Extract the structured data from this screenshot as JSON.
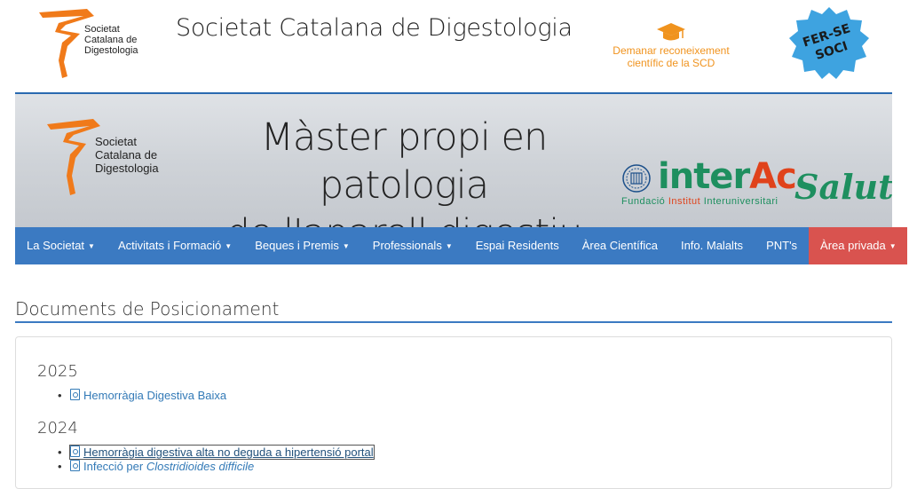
{
  "header": {
    "logo_text": [
      "Societat",
      "Catalana de",
      "Digestologia"
    ],
    "site_title": "Societat Catalana de Digestologia",
    "recognition_link": [
      "Demanar reconeixement",
      "científic de la SCD"
    ],
    "badge_text": [
      "FER-SE",
      "SOCI"
    ],
    "icons": [
      "graduation-cap-icon",
      "logo-icon"
    ],
    "accent_color": "#f0931e"
  },
  "banner": {
    "logo_text": [
      "Societat",
      "Catalana de",
      "Digestologia"
    ],
    "title_lines": [
      "Màster propi en patologia",
      "de  l'aparell digestiu"
    ],
    "partner": {
      "brand_a": "inter",
      "brand_b": "Ac",
      "brand_c": "Salut",
      "foundation_a": "Fundació",
      "foundation_b": "Institut",
      "foundation_c": "Interuniversitari"
    }
  },
  "nav": {
    "items": [
      {
        "label": "La Societat",
        "dropdown": true
      },
      {
        "label": "Activitats i Formació",
        "dropdown": true
      },
      {
        "label": "Beques i Premis",
        "dropdown": true
      },
      {
        "label": "Professionals",
        "dropdown": true
      },
      {
        "label": "Espai Residents",
        "dropdown": false
      },
      {
        "label": "Àrea Científica",
        "dropdown": false
      },
      {
        "label": "Info. Malalts",
        "dropdown": false
      },
      {
        "label": "PNT's",
        "dropdown": false
      }
    ],
    "private_area": "Àrea privada",
    "nav_color": "#3b7ac2",
    "private_color": "#d9534f"
  },
  "content": {
    "page_title": "Documents de Posicionament",
    "groups": [
      {
        "year": "2025",
        "docs": [
          {
            "title": "Hemorràgia Digestiva Baixa"
          }
        ]
      },
      {
        "year": "2024",
        "docs": [
          {
            "title": "Hemorràgia digestiva alta no deguda a hipertensió portal"
          },
          {
            "title_prefix": "Infecció per ",
            "title_italic": "Clostridioides difficile"
          }
        ]
      }
    ]
  }
}
